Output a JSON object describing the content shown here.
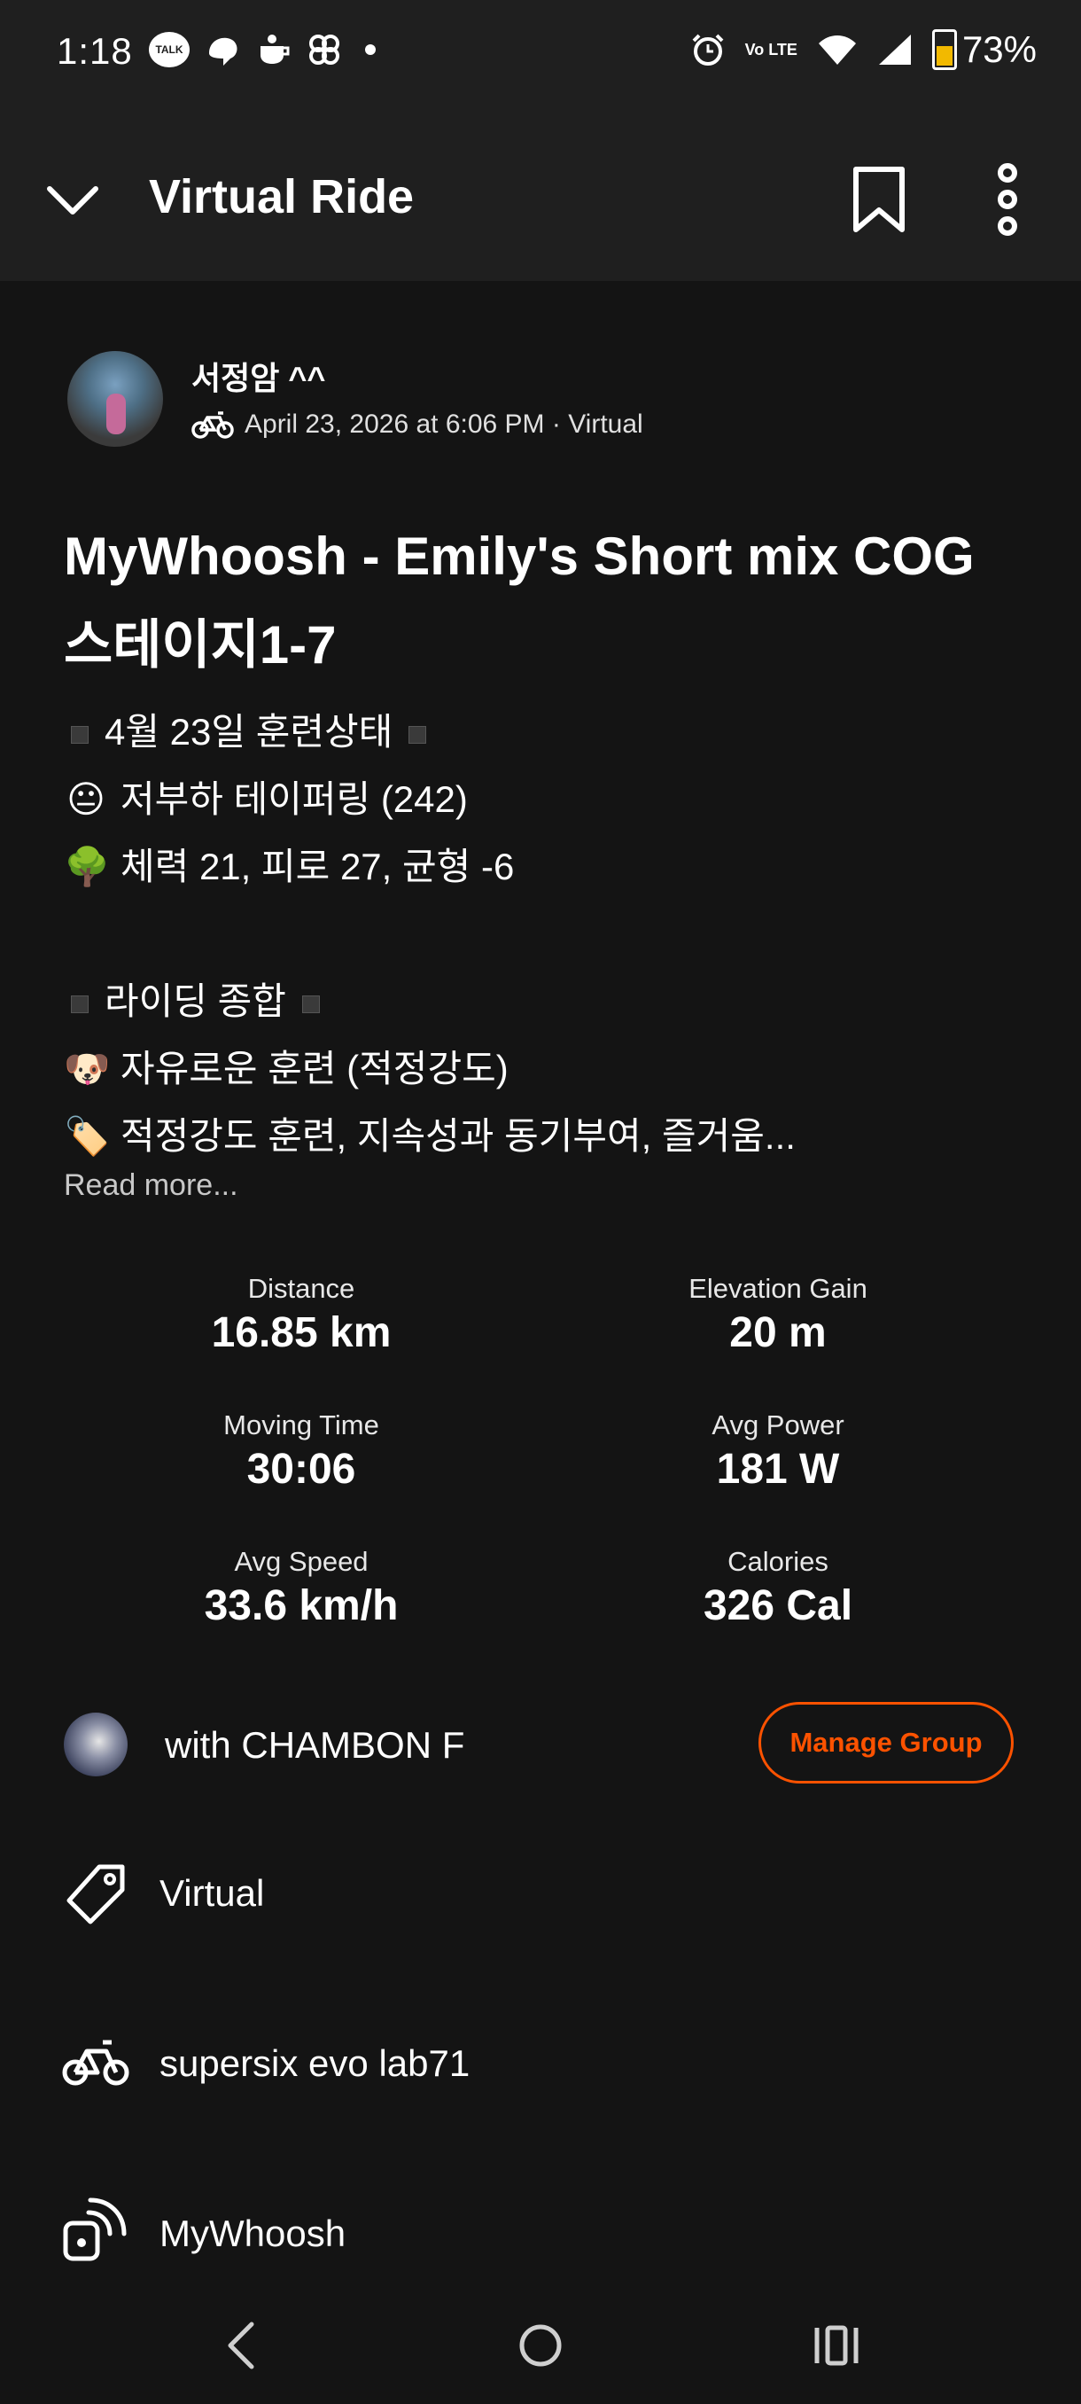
{
  "status_bar": {
    "time": "1:18",
    "talk_badge": "TALK",
    "lte_label": "Vo LTE",
    "battery": "73%"
  },
  "header": {
    "title": "Virtual Ride"
  },
  "author": {
    "name": "서정암 ^^",
    "meta": "April 23, 2026 at 6:06 PM · Virtual"
  },
  "activity": {
    "title": "MyWhoosh - Emily's Short mix COG 스테이지1-7",
    "description": {
      "line1": "4월 23일 훈련상태",
      "line2_emoji": "😐",
      "line2": "저부하 테이퍼링 (242)",
      "line3_emoji": "🌳",
      "line3": "체력 21, 피로 27, 균형 -6",
      "line4": "라이딩 종합",
      "line5_emoji": "🐶",
      "line5": "자유로운 훈련 (적정강도)",
      "line6_emoji": "🏷️",
      "line6": "적정강도 훈련, 지속성과 동기부여, 즐거움..."
    },
    "read_more": "Read more..."
  },
  "stats": {
    "distance_label": "Distance",
    "distance_value": "16.85 km",
    "elevation_label": "Elevation Gain",
    "elevation_value": "20 m",
    "moving_label": "Moving Time",
    "moving_value": "30:06",
    "power_label": "Avg Power",
    "power_value": "181 W",
    "speed_label": "Avg Speed",
    "speed_value": "33.6 km/h",
    "calories_label": "Calories",
    "calories_value": "326 Cal"
  },
  "group": {
    "text": "with CHAMBON F",
    "manage_button": "Manage Group"
  },
  "rows": {
    "tag": "Virtual",
    "bike": "supersix evo lab71",
    "device": "MyWhoosh"
  },
  "colors": {
    "accent": "#fc5200",
    "background": "#141414",
    "header": "#1f1f1f"
  }
}
